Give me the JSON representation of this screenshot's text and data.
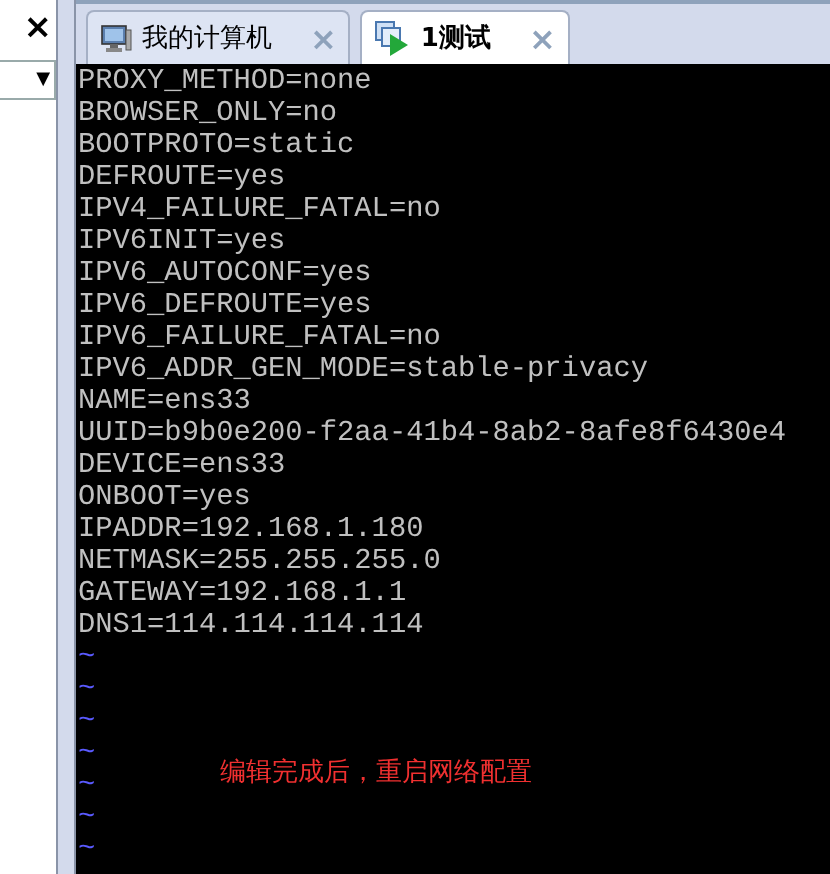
{
  "left_panel": {
    "close": "×",
    "dropdown": {
      "caret": "▼"
    }
  },
  "tabs": [
    {
      "label": "我的计算机",
      "close": "×",
      "selected": false
    },
    {
      "label": "1测试",
      "close": "×",
      "selected": true
    }
  ],
  "terminal": {
    "lines": [
      "PROXY_METHOD=none",
      "BROWSER_ONLY=no",
      "BOOTPROTO=static",
      "DEFROUTE=yes",
      "IPV4_FAILURE_FATAL=no",
      "IPV6INIT=yes",
      "IPV6_AUTOCONF=yes",
      "IPV6_DEFROUTE=yes",
      "IPV6_FAILURE_FATAL=no",
      "IPV6_ADDR_GEN_MODE=stable-privacy",
      "NAME=ens33",
      "UUID=b9b0e200-f2aa-41b4-8ab2-8afe8f6430e4",
      "DEVICE=ens33",
      "ONBOOT=yes",
      "IPADDR=192.168.1.180",
      "NETMASK=255.255.255.0",
      "GATEWAY=192.168.1.1",
      "DNS1=114.114.114.114"
    ],
    "empty_markers": [
      "~",
      "~",
      "~",
      "~",
      "~",
      "~",
      "~"
    ],
    "note": "编辑完成后，重启网络配置"
  }
}
